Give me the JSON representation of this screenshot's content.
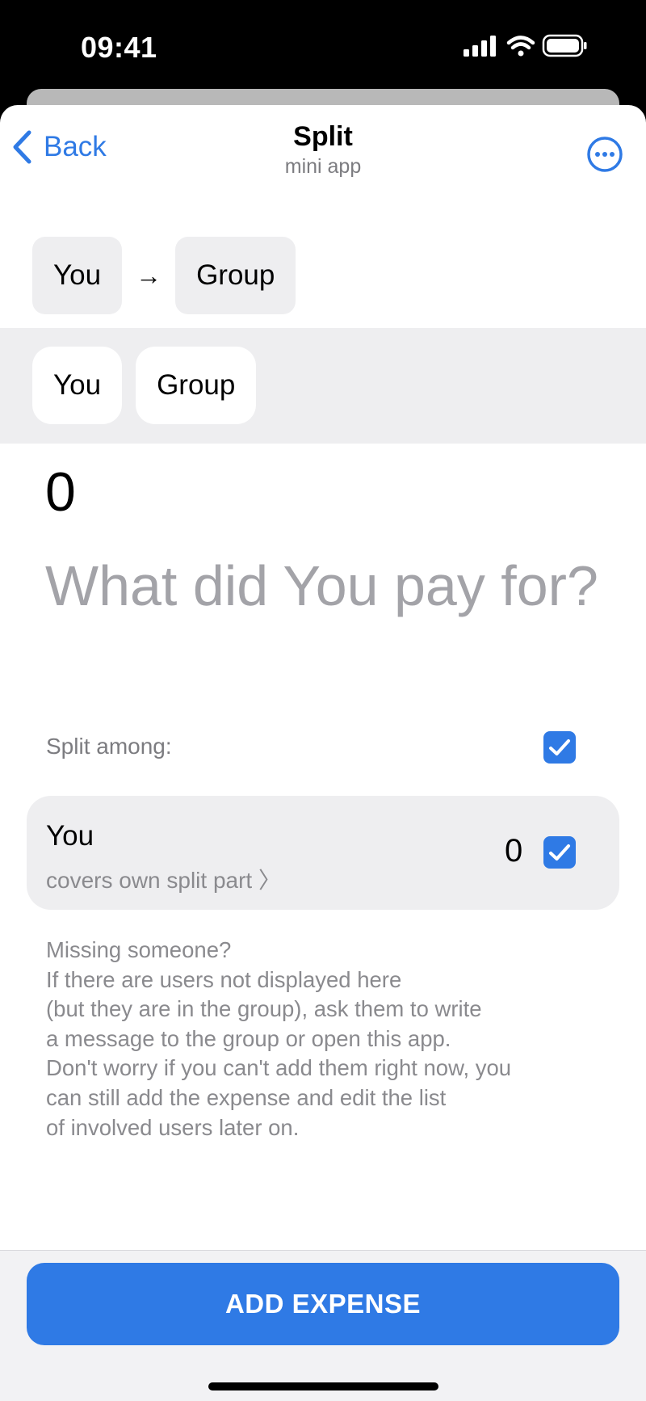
{
  "status_bar": {
    "time": "09:41",
    "icons": [
      "signal-icon",
      "wifi-icon",
      "battery-icon"
    ]
  },
  "nav": {
    "back_label": "Back",
    "title": "Split",
    "subtitle": "mini app",
    "more_icon": "ellipsis-circle-icon"
  },
  "route": {
    "from": "You",
    "arrow": "→",
    "to": "Group"
  },
  "picker": {
    "options": [
      "You",
      "Group"
    ]
  },
  "expense": {
    "amount": "0",
    "description_placeholder": "What did You pay for?"
  },
  "split": {
    "label": "Split among:",
    "all_checked": true,
    "users": [
      {
        "name": "You",
        "subtitle": "covers own split part 〉",
        "amount": "0",
        "checked": true
      }
    ]
  },
  "info": {
    "text": "Missing someone?\nIf there are users not displayed here\n(but they are in the group), ask them to write\na message to the group or open this app.\nDon't worry if you can't add them right now, you\ncan still add the expense and edit the list\nof involved users later on."
  },
  "actions": {
    "add_expense_label": "ADD EXPENSE"
  },
  "colors": {
    "accent": "#2f7ae5",
    "chip_background": "#eeeef0",
    "secondary_text": "#8a8a8e"
  }
}
